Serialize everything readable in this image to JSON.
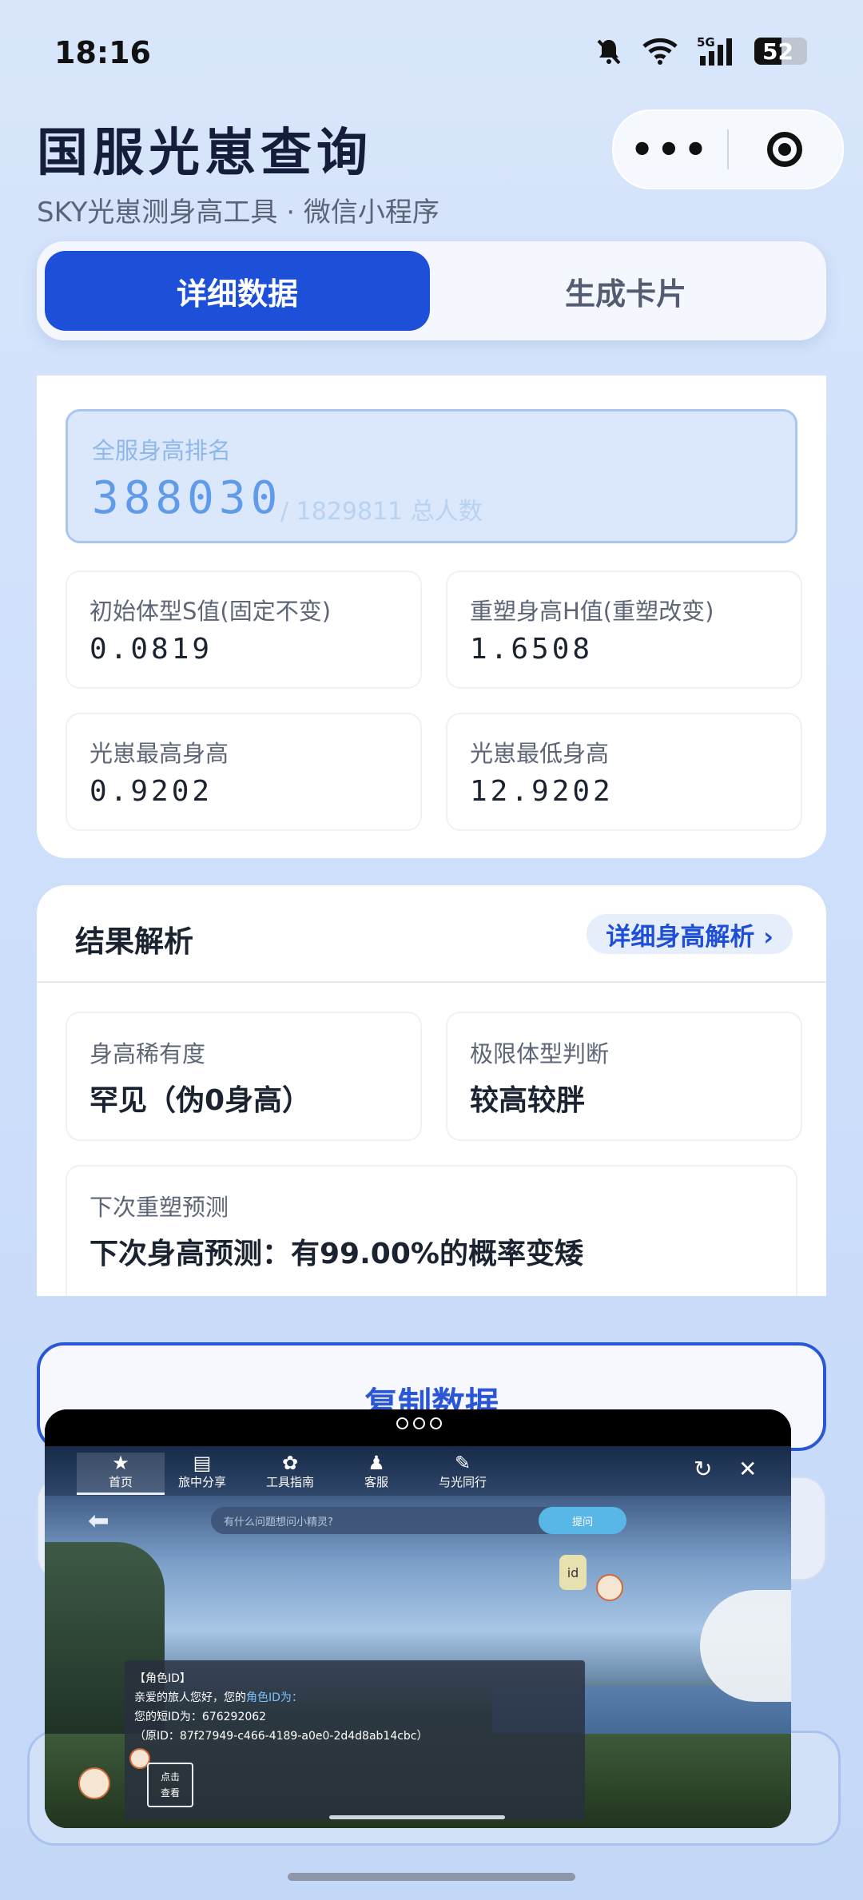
{
  "status": {
    "time": "18:16",
    "battery": "52"
  },
  "header": {
    "title": "国服光崽查询",
    "subtitle": "SKY光崽测身高工具 · 微信小程序"
  },
  "capsule": {
    "more": "•••"
  },
  "tabs": {
    "active": "详细数据",
    "other": "生成卡片"
  },
  "rank": {
    "label": "全服身高排名",
    "value": "388030",
    "total": "/ 1829811 总人数"
  },
  "stats": [
    {
      "label": "初始体型S值(固定不变)",
      "value": "0.0819"
    },
    {
      "label": "重塑身高H值(重塑改变)",
      "value": "1.6508"
    },
    {
      "label": "光崽最高身高",
      "value": "0.9202"
    },
    {
      "label": "光崽最低身高",
      "value": "12.9202"
    }
  ],
  "result": {
    "title": "结果解析",
    "detail_button": "详细身高解析 ›",
    "rarity": {
      "label": "身高稀有度",
      "value": "罕见（伪0身高）"
    },
    "body_type": {
      "label": "极限体型判断",
      "value": "较高较胖"
    },
    "next": {
      "label": "下次重塑预测",
      "value": "下次身高预测：有99.00%的概率变矮"
    }
  },
  "copy_button": "复制数据",
  "game": {
    "nav": [
      {
        "icon": "★",
        "label": "首页"
      },
      {
        "icon": "▤",
        "label": "旅中分享"
      },
      {
        "icon": "✿",
        "label": "工具指南"
      },
      {
        "icon": "♟",
        "label": "客服"
      },
      {
        "icon": "✎",
        "label": "与光同行"
      }
    ],
    "refresh": "↻",
    "close": "✕",
    "back": "⬅",
    "search_placeholder": "有什么问题想问小精灵?",
    "search_button": "提问",
    "id_bubble": "id",
    "chat": {
      "line1": "【角色ID】",
      "line2a": "亲爱的旅人您好，您的",
      "line2b": "角色ID为：",
      "line3": "您的短ID为：676292062",
      "line4": "（原ID：87f27949-c466-4189-a0e0-2d4d8ab14cbc）",
      "tap": "点击\n查看"
    }
  }
}
